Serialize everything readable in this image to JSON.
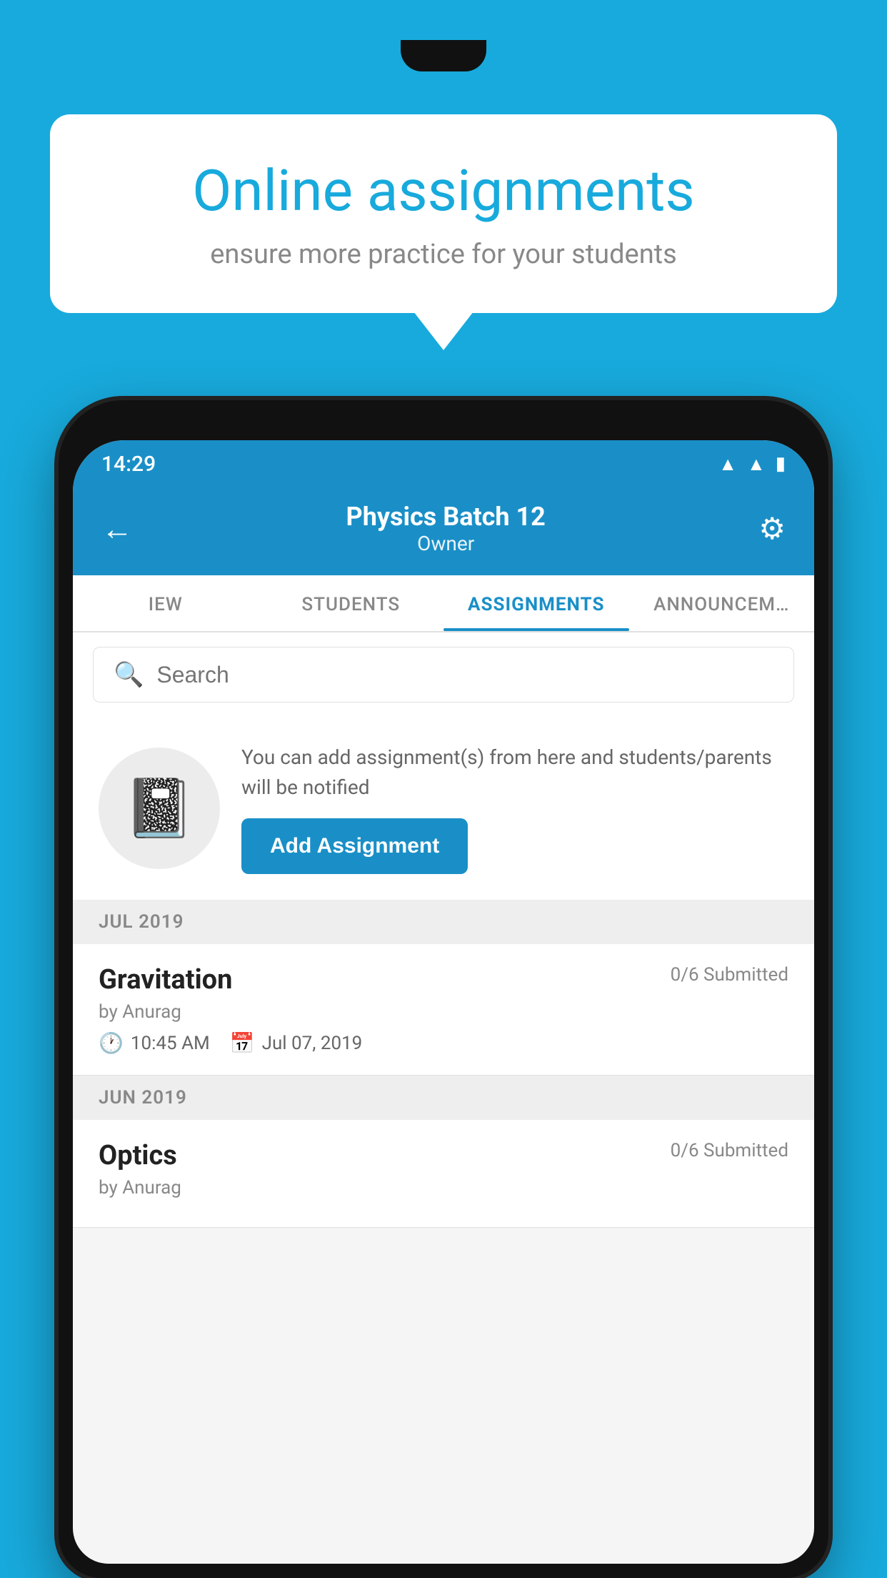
{
  "background_color": "#18AADC",
  "speech_bubble": {
    "title": "Online assignments",
    "subtitle": "ensure more practice for your students"
  },
  "status_bar": {
    "time": "14:29",
    "icons": [
      "wifi",
      "signal",
      "battery"
    ]
  },
  "app_header": {
    "title": "Physics Batch 12",
    "subtitle": "Owner",
    "back_label": "←",
    "settings_label": "⚙"
  },
  "tabs": [
    {
      "label": "IEW",
      "active": false
    },
    {
      "label": "STUDENTS",
      "active": false
    },
    {
      "label": "ASSIGNMENTS",
      "active": true
    },
    {
      "label": "ANNOUNCEM…",
      "active": false
    }
  ],
  "search": {
    "placeholder": "Search"
  },
  "promo": {
    "description": "You can add assignment(s) from here and students/parents will be notified",
    "button_label": "Add Assignment"
  },
  "sections": [
    {
      "month_label": "JUL 2019",
      "assignments": [
        {
          "name": "Gravitation",
          "submitted": "0/6 Submitted",
          "by": "by Anurag",
          "time": "10:45 AM",
          "date": "Jul 07, 2019"
        }
      ]
    },
    {
      "month_label": "JUN 2019",
      "assignments": [
        {
          "name": "Optics",
          "submitted": "0/6 Submitted",
          "by": "by Anurag",
          "time": "",
          "date": ""
        }
      ]
    }
  ]
}
